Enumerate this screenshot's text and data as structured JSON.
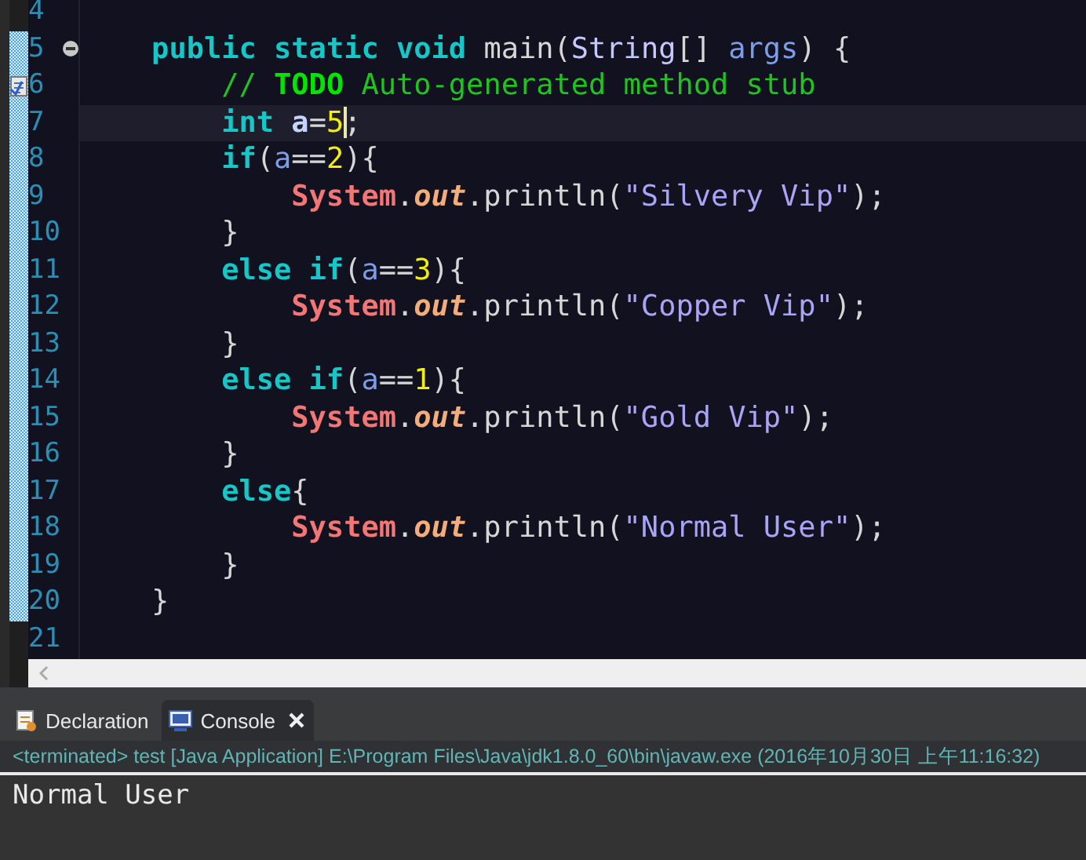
{
  "editor": {
    "lines": [
      {
        "number": "4",
        "current": false
      },
      {
        "number": "5",
        "current": false,
        "fold": true,
        "tokens": [
          {
            "text": "    public",
            "kind": "kw"
          },
          {
            "text": " static",
            "kind": "kw"
          },
          {
            "text": " void",
            "kind": "kw"
          },
          {
            "text": " main(",
            "kind": "plain"
          },
          {
            "text": "String",
            "kind": "type"
          },
          {
            "text": "[] ",
            "kind": "plain"
          },
          {
            "text": "args",
            "kind": "param"
          },
          {
            "text": ") {",
            "kind": "plain"
          }
        ]
      },
      {
        "number": "6",
        "current": false,
        "task": true,
        "tokens": [
          {
            "text": "        // ",
            "kind": "comment"
          },
          {
            "text": "TODO",
            "kind": "todo"
          },
          {
            "text": " Auto-generated method stub",
            "kind": "comment"
          }
        ]
      },
      {
        "number": "7",
        "current": true,
        "tokens": [
          {
            "text": "        int",
            "kind": "kw"
          },
          {
            "text": " a",
            "kind": "decl"
          },
          {
            "text": "=",
            "kind": "plain"
          },
          {
            "text": "5",
            "kind": "num"
          },
          {
            "text": ";",
            "kind": "plain"
          }
        ]
      },
      {
        "number": "8",
        "current": false,
        "tokens": [
          {
            "text": "        if",
            "kind": "kw"
          },
          {
            "text": "(",
            "kind": "plain"
          },
          {
            "text": "a",
            "kind": "var"
          },
          {
            "text": "==",
            "kind": "plain"
          },
          {
            "text": "2",
            "kind": "num"
          },
          {
            "text": "){",
            "kind": "plain"
          }
        ]
      },
      {
        "number": "9",
        "current": false,
        "tokens": [
          {
            "text": "            System",
            "kind": "cls"
          },
          {
            "text": ".",
            "kind": "plain"
          },
          {
            "text": "out",
            "kind": "field"
          },
          {
            "text": ".println(",
            "kind": "plain"
          },
          {
            "text": "\"Silvery Vip\"",
            "kind": "str"
          },
          {
            "text": ");",
            "kind": "plain"
          }
        ]
      },
      {
        "number": "10",
        "current": false,
        "tokens": [
          {
            "text": "        }",
            "kind": "plain"
          }
        ]
      },
      {
        "number": "11",
        "current": false,
        "tokens": [
          {
            "text": "        else",
            "kind": "kw"
          },
          {
            "text": " if",
            "kind": "kw"
          },
          {
            "text": "(",
            "kind": "plain"
          },
          {
            "text": "a",
            "kind": "var"
          },
          {
            "text": "==",
            "kind": "plain"
          },
          {
            "text": "3",
            "kind": "num"
          },
          {
            "text": "){",
            "kind": "plain"
          }
        ]
      },
      {
        "number": "12",
        "current": false,
        "tokens": [
          {
            "text": "            System",
            "kind": "cls"
          },
          {
            "text": ".",
            "kind": "plain"
          },
          {
            "text": "out",
            "kind": "field"
          },
          {
            "text": ".println(",
            "kind": "plain"
          },
          {
            "text": "\"Copper Vip\"",
            "kind": "str"
          },
          {
            "text": ");",
            "kind": "plain"
          }
        ]
      },
      {
        "number": "13",
        "current": false,
        "tokens": [
          {
            "text": "        }",
            "kind": "plain"
          }
        ]
      },
      {
        "number": "14",
        "current": false,
        "tokens": [
          {
            "text": "        else",
            "kind": "kw"
          },
          {
            "text": " if",
            "kind": "kw"
          },
          {
            "text": "(",
            "kind": "plain"
          },
          {
            "text": "a",
            "kind": "var"
          },
          {
            "text": "==",
            "kind": "plain"
          },
          {
            "text": "1",
            "kind": "num"
          },
          {
            "text": "){",
            "kind": "plain"
          }
        ]
      },
      {
        "number": "15",
        "current": false,
        "tokens": [
          {
            "text": "            System",
            "kind": "cls"
          },
          {
            "text": ".",
            "kind": "plain"
          },
          {
            "text": "out",
            "kind": "field"
          },
          {
            "text": ".println(",
            "kind": "plain"
          },
          {
            "text": "\"Gold Vip\"",
            "kind": "str"
          },
          {
            "text": ");",
            "kind": "plain"
          }
        ]
      },
      {
        "number": "16",
        "current": false,
        "tokens": [
          {
            "text": "        }",
            "kind": "plain"
          }
        ]
      },
      {
        "number": "17",
        "current": false,
        "tokens": [
          {
            "text": "        else",
            "kind": "kw"
          },
          {
            "text": "{",
            "kind": "plain"
          }
        ]
      },
      {
        "number": "18",
        "current": false,
        "tokens": [
          {
            "text": "            System",
            "kind": "cls"
          },
          {
            "text": ".",
            "kind": "plain"
          },
          {
            "text": "out",
            "kind": "field"
          },
          {
            "text": ".println(",
            "kind": "plain"
          },
          {
            "text": "\"Normal User\"",
            "kind": "str"
          },
          {
            "text": ");",
            "kind": "plain"
          }
        ]
      },
      {
        "number": "19",
        "current": false,
        "tokens": [
          {
            "text": "        }",
            "kind": "plain"
          }
        ]
      },
      {
        "number": "20",
        "current": false,
        "tokens": [
          {
            "text": "    }",
            "kind": "plain"
          }
        ]
      },
      {
        "number": "21",
        "current": false
      }
    ]
  },
  "tabs": [
    {
      "label": "Declaration",
      "selected": false
    },
    {
      "label": "Console",
      "selected": true
    }
  ],
  "console": {
    "header": "<terminated> test [Java Application] E:\\Program Files\\Java\\jdk1.8.0_60\\bin\\javaw.exe (2016年10月30日 上午11:16:32)",
    "output": "Normal User"
  }
}
